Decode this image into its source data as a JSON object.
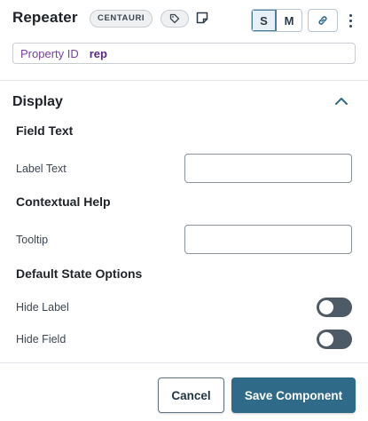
{
  "header": {
    "title": "Repeater",
    "badge": "CENTAURI",
    "size_options": [
      "S",
      "M"
    ],
    "selected_size": "S"
  },
  "property": {
    "label": "Property ID",
    "value": "rep"
  },
  "display": {
    "title": "Display",
    "field_text": {
      "heading": "Field Text",
      "label_text_label": "Label Text",
      "label_text_value": ""
    },
    "contextual_help": {
      "heading": "Contextual Help",
      "tooltip_label": "Tooltip",
      "tooltip_value": ""
    },
    "default_state": {
      "heading": "Default State Options",
      "hide_label": "Hide Label",
      "hide_label_on": false,
      "hide_field": "Hide Field",
      "hide_field_on": false
    }
  },
  "footer": {
    "cancel_label": "Cancel",
    "save_label": "Save Component"
  },
  "colors": {
    "primary": "#2f6a88",
    "toggle_off": "#4e5a66",
    "property_label": "#7b3fa0"
  },
  "icons": {
    "tag": "tag-icon",
    "note": "note-icon",
    "link": "link-icon",
    "more": "kebab-menu-icon",
    "collapse": "chevron-up-icon"
  }
}
